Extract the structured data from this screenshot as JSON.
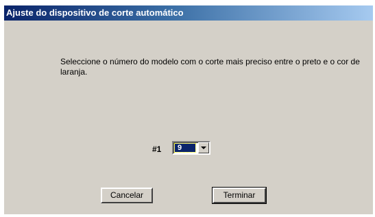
{
  "window": {
    "title": "Ajuste do dispositivo de corte automático"
  },
  "main": {
    "instruction": "Seleccione o número do modelo com o corte mais preciso entre o preto e o cor de laranja.",
    "model_label": "#1",
    "model_selected_value": "9"
  },
  "buttons": {
    "cancel_label": "Cancelar",
    "finish_label": "Terminar"
  },
  "colors": {
    "dialog_background": "#d4d0c8",
    "titlebar_start": "#0a246a",
    "titlebar_end": "#a6caf0",
    "selection_background": "#0a246a"
  },
  "icons": {
    "combo_arrow": "chevron-down-icon"
  }
}
